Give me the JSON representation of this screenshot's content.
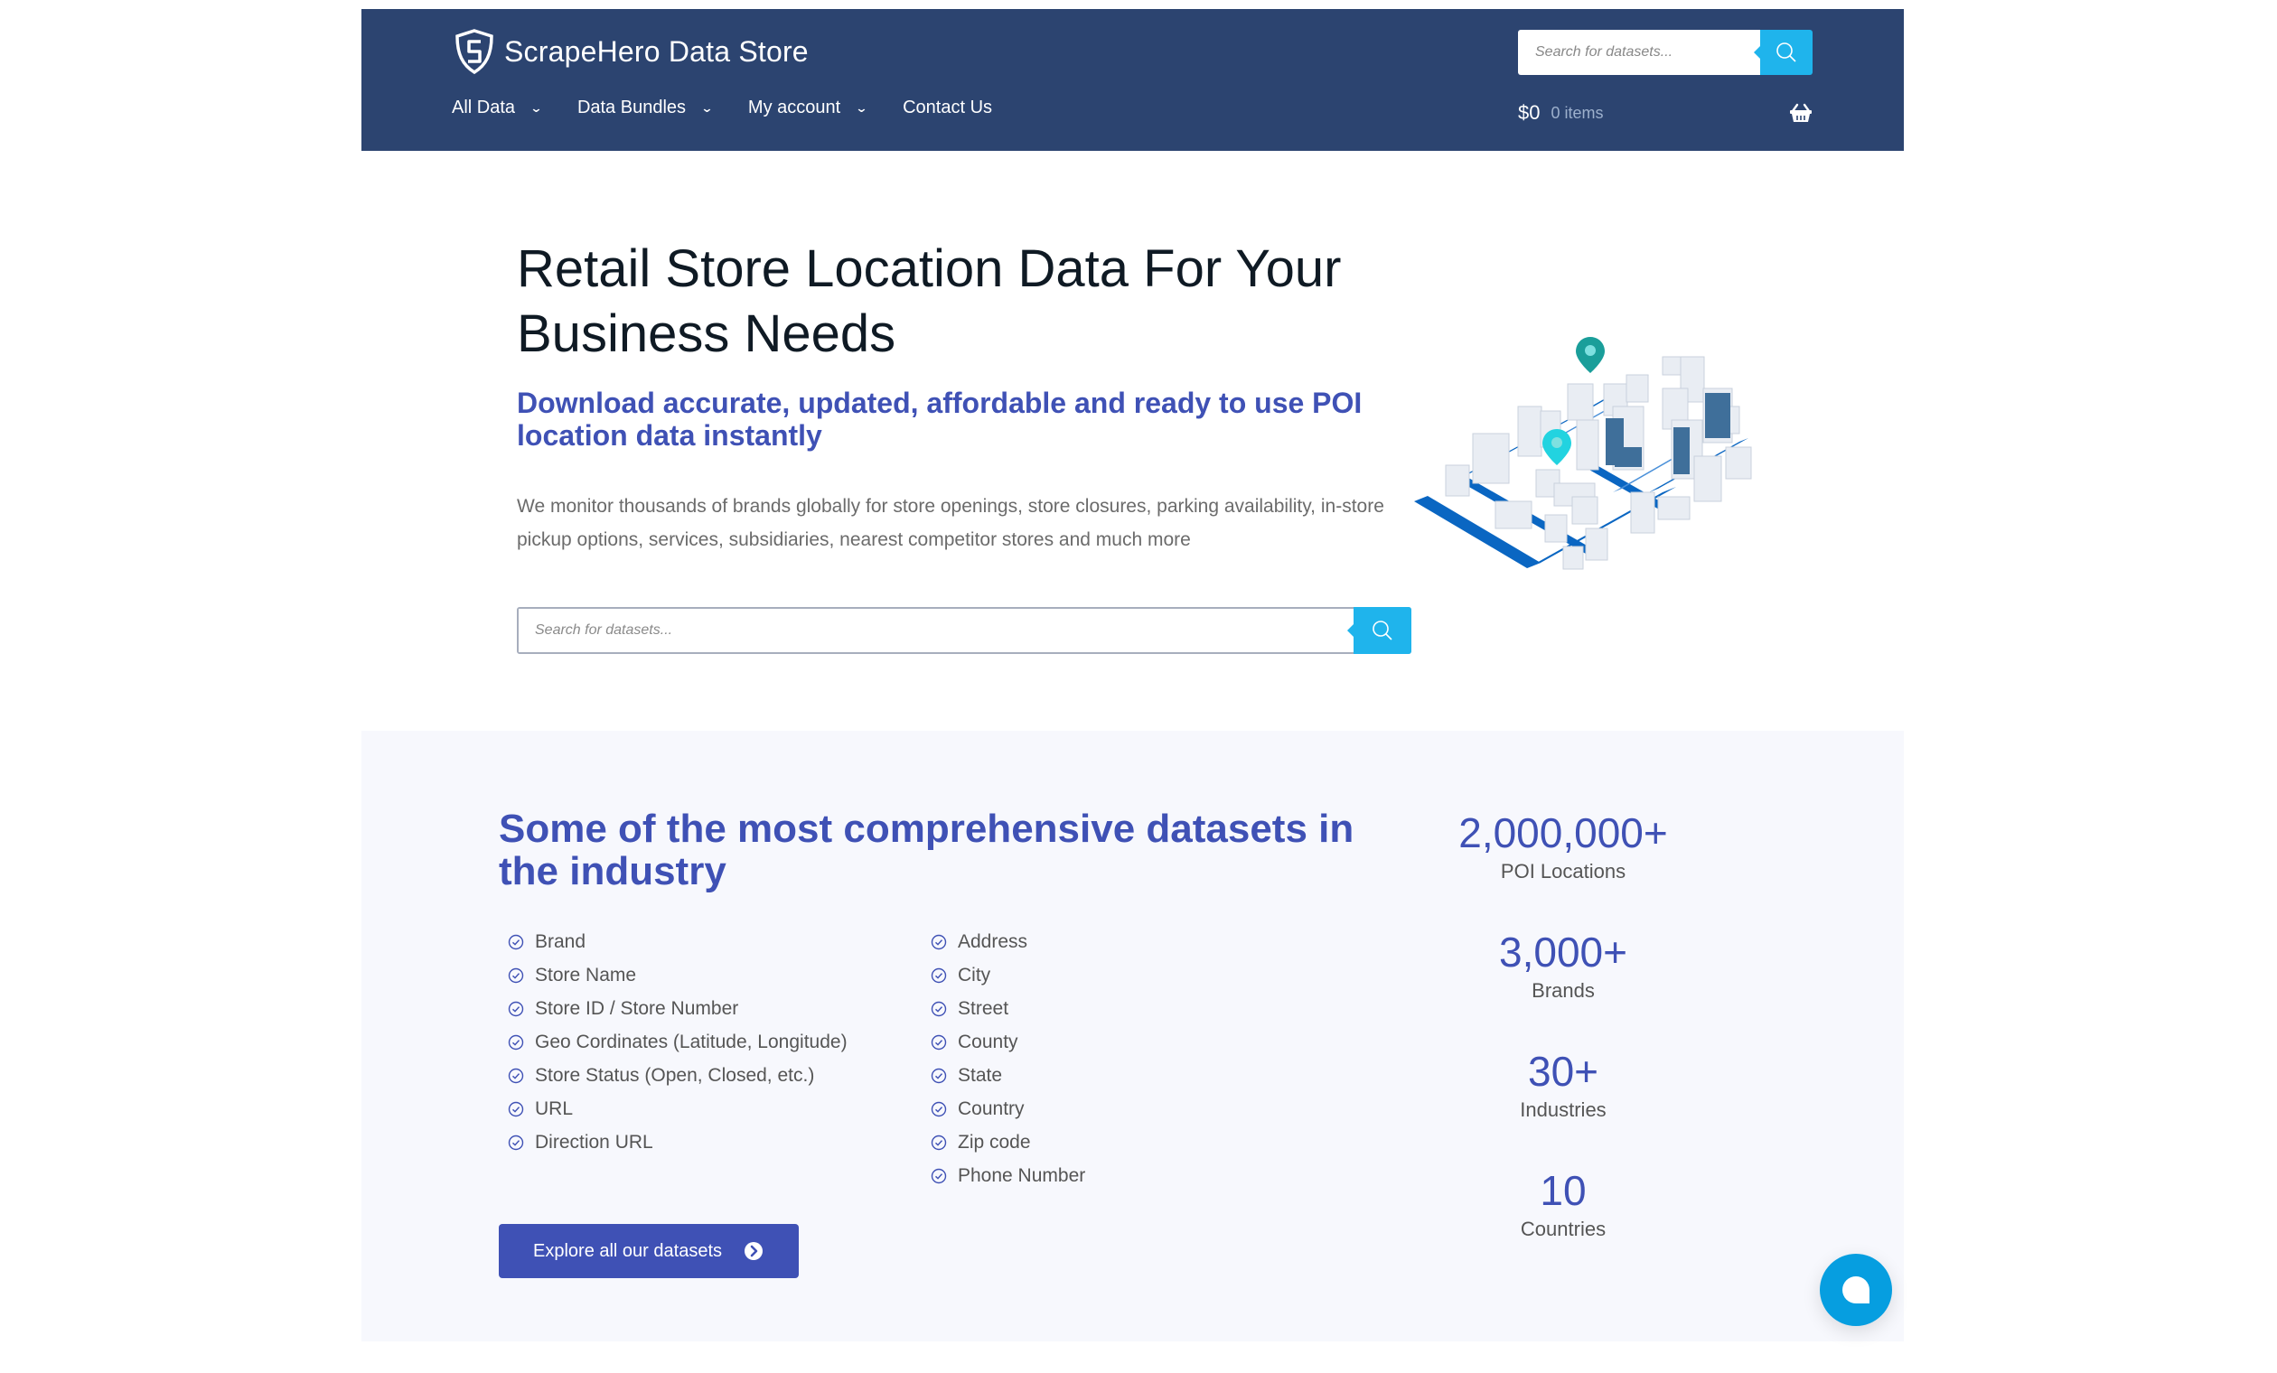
{
  "header": {
    "logo_text": "ScrapeHero Data Store",
    "nav": [
      {
        "label": "All Data",
        "has_dropdown": true
      },
      {
        "label": "Data Bundles",
        "has_dropdown": true
      },
      {
        "label": "My account",
        "has_dropdown": true
      },
      {
        "label": "Contact Us",
        "has_dropdown": false
      }
    ],
    "search": {
      "placeholder": "Search for datasets...",
      "value": ""
    },
    "cart": {
      "amount": "$0",
      "items": "0 items"
    }
  },
  "hero": {
    "title": "Retail Store Location Data For Your Business Needs",
    "subtitle": "Download accurate, updated, affordable and ready to use POI location data instantly",
    "description": "We monitor thousands of brands globally for store openings, store closures, parking availability, in-store pickup options, services, subsidiaries, nearest competitor stores and much more",
    "search": {
      "placeholder": "Search for datasets...",
      "value": ""
    }
  },
  "datasets": {
    "title": "Some of the most comprehensive datasets in the industry",
    "fields_col1": [
      "Brand",
      "Store Name",
      "Store ID / Store Number",
      "Geo Cordinates (Latitude, Longitude)",
      "Store Status (Open, Closed, etc.)",
      "URL",
      "Direction URL"
    ],
    "fields_col2": [
      "Address",
      "City",
      "Street",
      "County",
      "State",
      "Country",
      "Zip code",
      "Phone Number"
    ],
    "button_label": "Explore all our datasets",
    "stats": [
      {
        "value": "2,000,000+",
        "label": "POI Locations"
      },
      {
        "value": "3,000+",
        "label": "Brands"
      },
      {
        "value": "30+",
        "label": "Industries"
      },
      {
        "value": "10",
        "label": "Countries"
      }
    ]
  },
  "colors": {
    "header_bg": "#2c4470",
    "accent_blue": "#3f51b5",
    "search_button": "#1fb4ec",
    "section_bg": "#f7f8fd",
    "chat_button": "#069ee0"
  }
}
